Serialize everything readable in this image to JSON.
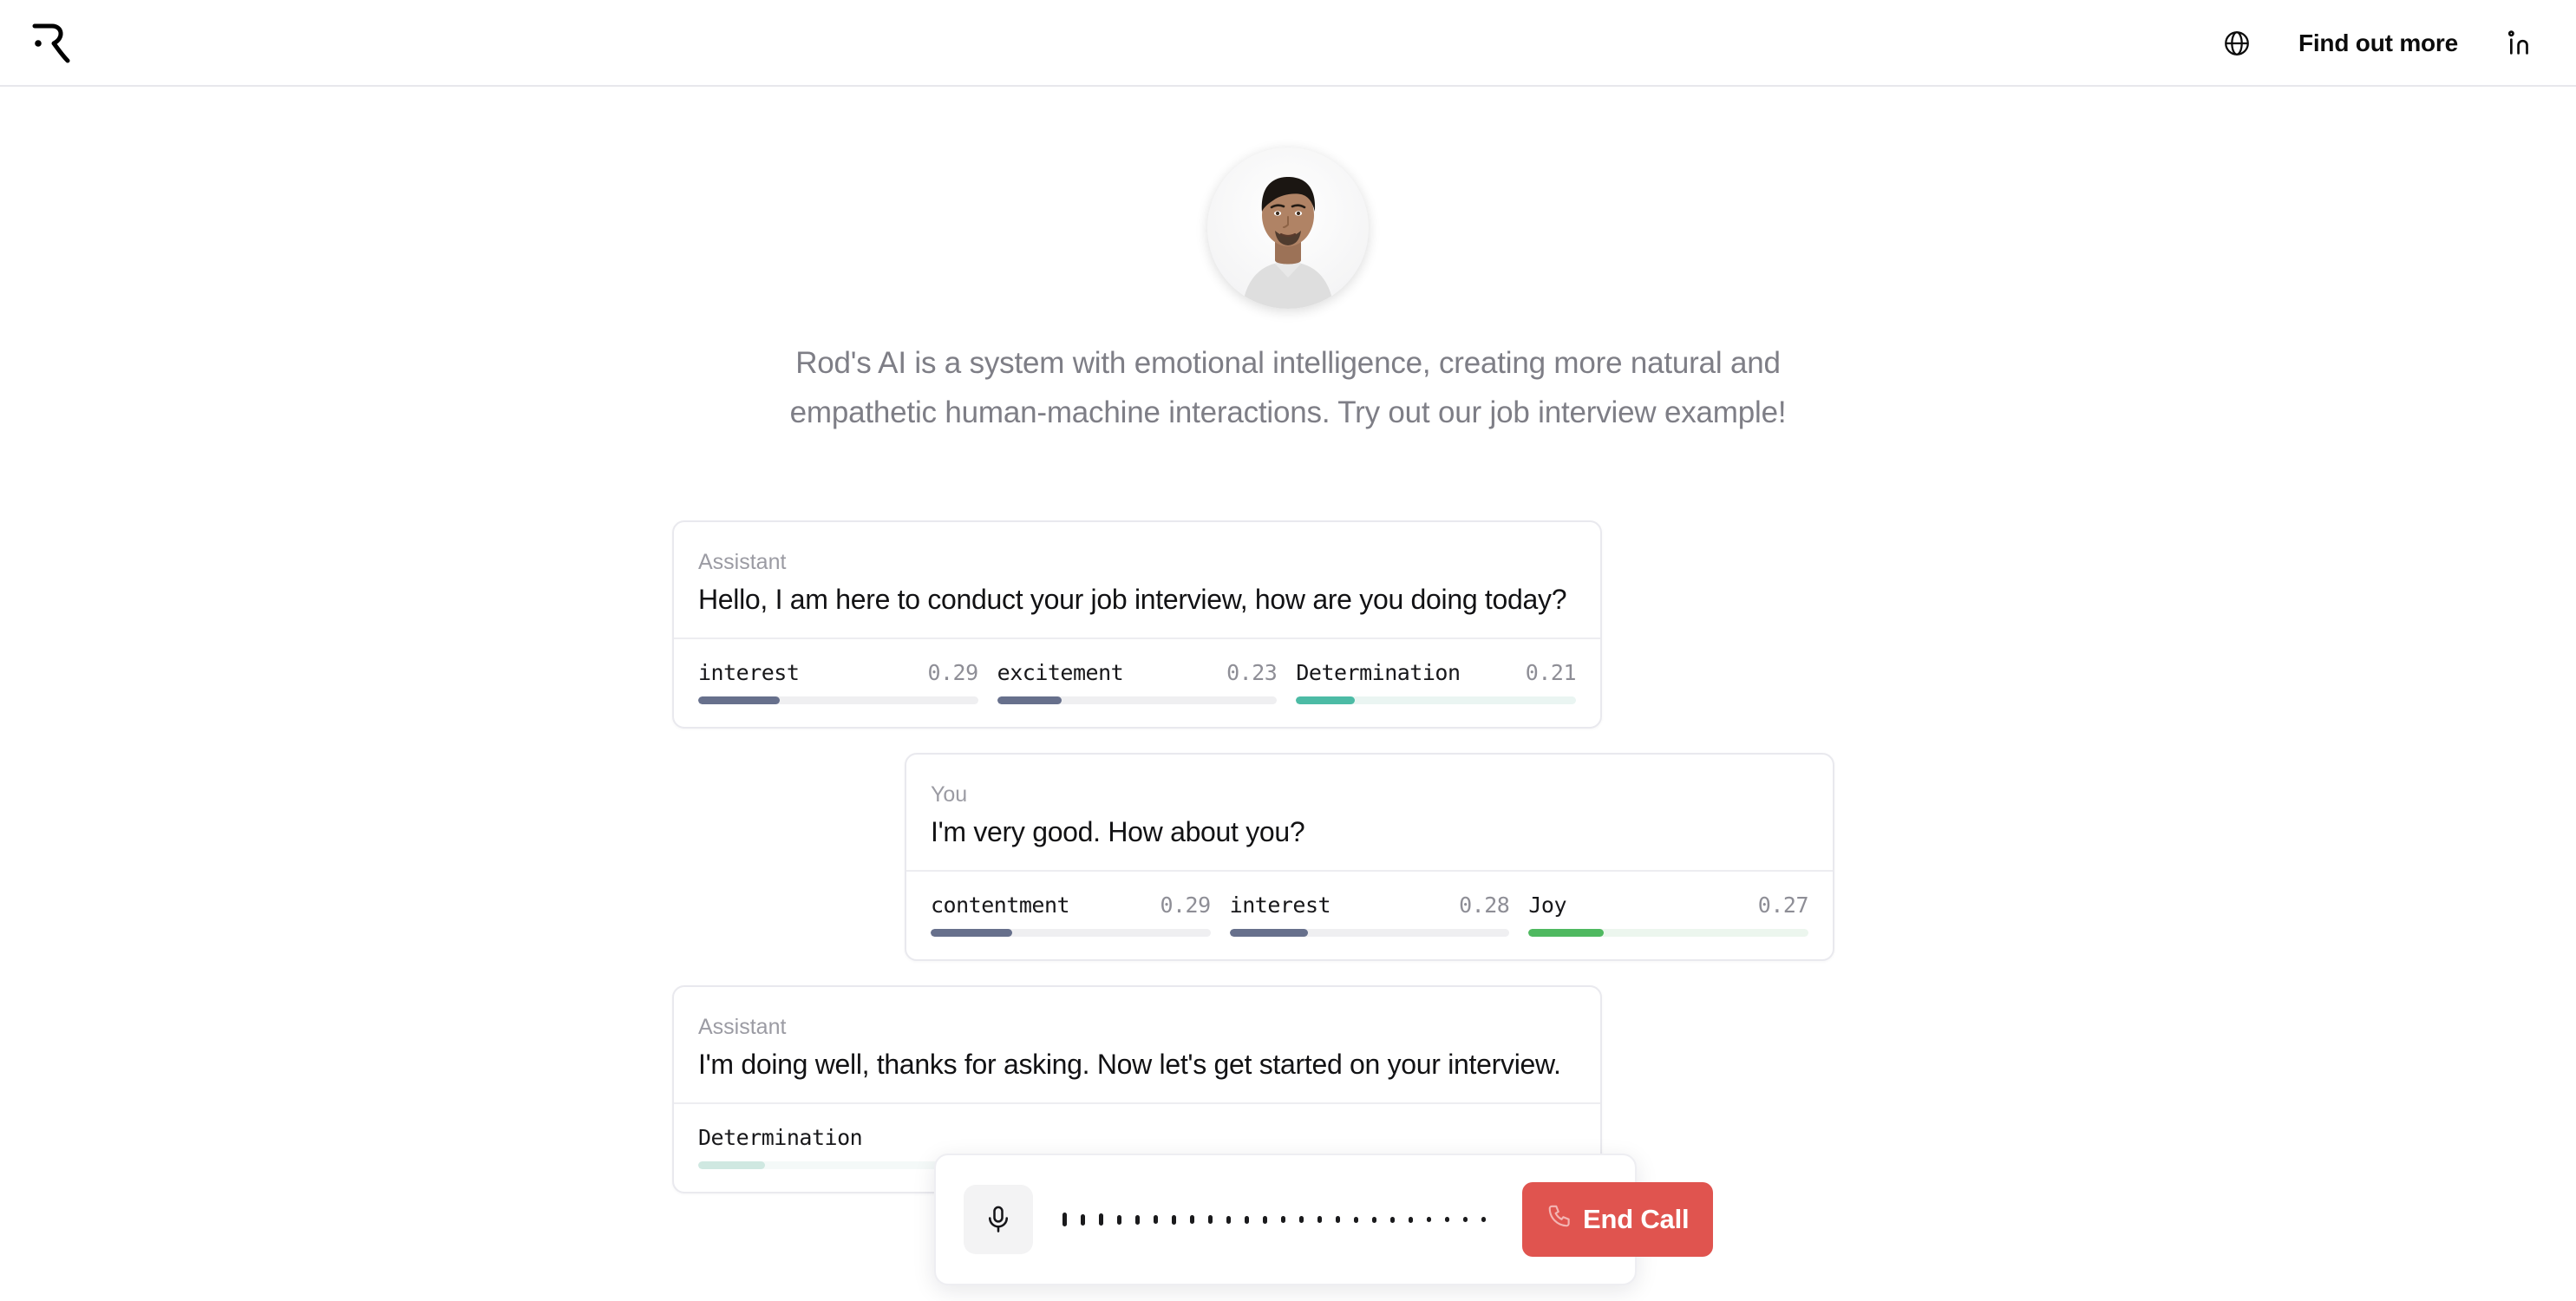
{
  "header": {
    "logo_alt": "Rod's AI logo",
    "language_icon": "globe-icon",
    "find_out_more_label": "Find out more",
    "linkedin_icon": "linkedin-icon"
  },
  "intro": {
    "avatar_alt": "Assistant avatar portrait",
    "description": "Rod's AI is a system with emotional intelligence, creating more natural and empathetic human-machine interactions. Try out our job interview example!"
  },
  "conversation": {
    "messages": [
      {
        "role": "Assistant",
        "text": "Hello, I am here to conduct your job interview, how are you doing today?",
        "align": "left",
        "emotions": [
          {
            "name": "interest",
            "value": "0.29",
            "pct": 29,
            "color": "#67708c",
            "track": "#efeff1"
          },
          {
            "name": "excitement",
            "value": "0.23",
            "pct": 23,
            "color": "#67708c",
            "track": "#efeff1"
          },
          {
            "name": "Determination",
            "value": "0.21",
            "pct": 21,
            "color": "#4cbba5",
            "track": "#eaf5f2"
          }
        ]
      },
      {
        "role": "You",
        "text": "I'm very good. How about you?",
        "align": "right",
        "emotions": [
          {
            "name": "contentment",
            "value": "0.29",
            "pct": 29,
            "color": "#67708c",
            "track": "#efeff1"
          },
          {
            "name": "interest",
            "value": "0.28",
            "pct": 28,
            "color": "#67708c",
            "track": "#efeff1"
          },
          {
            "name": "Joy",
            "value": "0.27",
            "pct": 27,
            "color": "#4fb960",
            "track": "#ecf6ee"
          }
        ]
      },
      {
        "role": "Assistant",
        "text": "I'm doing well, thanks for asking. Now let's get started on your interview.",
        "align": "left",
        "emotions": [
          {
            "name": "Determination",
            "value": "",
            "pct": 24,
            "color": "#cfe8e1",
            "track": "#f4f9f8"
          }
        ]
      }
    ]
  },
  "call_controls": {
    "mic_icon": "microphone-icon",
    "waveform_heights": [
      16,
      13,
      14,
      11,
      11,
      10,
      11,
      10,
      10,
      9,
      9,
      9,
      8,
      8,
      8,
      8,
      7,
      7,
      7,
      7,
      6,
      6,
      6,
      6
    ],
    "end_call_label": "End Call",
    "end_call_icon": "phone-icon",
    "end_call_color": "#e0544f"
  }
}
